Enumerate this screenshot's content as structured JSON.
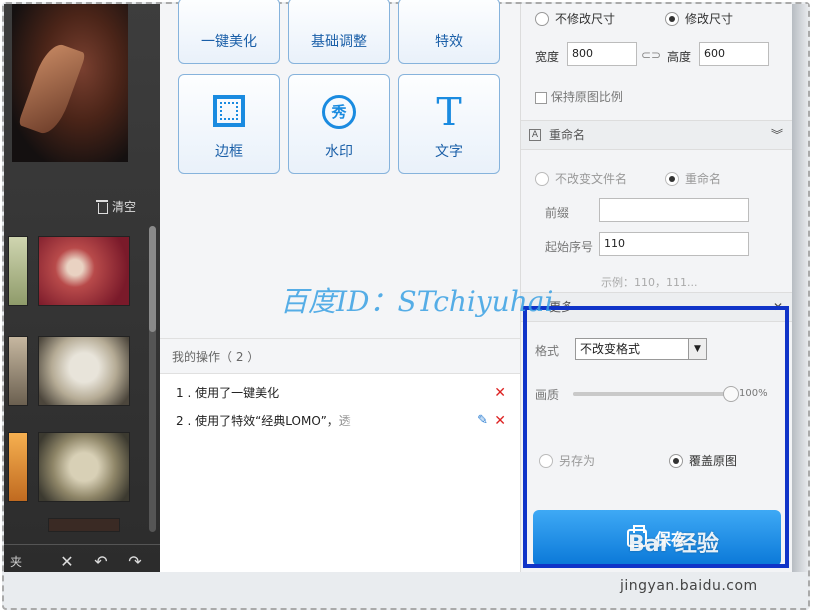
{
  "left_panel": {
    "clear_label": "清空",
    "folder_label_fragment": "夹"
  },
  "tools": [
    {
      "id": "one-click",
      "label": "一键美化"
    },
    {
      "id": "basic-adjust",
      "label": "基础调整"
    },
    {
      "id": "effects",
      "label": "特效"
    },
    {
      "id": "frame",
      "label": "边框"
    },
    {
      "id": "watermark",
      "label": "水印",
      "icon_text": "秀"
    },
    {
      "id": "text",
      "label": "文字",
      "icon_text": "T"
    }
  ],
  "operations": {
    "header": "我的操作（ 2 ）",
    "items": [
      {
        "text": "1 . 使用了一键美化"
      },
      {
        "text": "2 . 使用了特效“经典LOMO”，透"
      }
    ]
  },
  "resize": {
    "option_keep": "不修改尺寸",
    "option_change": "修改尺寸",
    "width_label": "宽度",
    "width_value": "800",
    "height_label": "高度",
    "height_value": "600",
    "keep_ratio_label": "保持原图比例"
  },
  "rename": {
    "section_title": "重命名",
    "option_keep": "不改变文件名",
    "option_rename": "重命名",
    "prefix_label": "前缀",
    "prefix_value": "",
    "start_label": "起始序号",
    "start_value": "110",
    "example": "示例：110，111..."
  },
  "more": {
    "section_title": "更多",
    "format_label": "格式",
    "format_value": "不改变格式",
    "quality_label": "画质",
    "quality_value": "100%",
    "quality_level": 1.0,
    "option_save_as": "另存为",
    "option_overwrite": "覆盖原图",
    "save_label": "保存"
  },
  "overlay": {
    "watermark": "百度ID：STchiyuhai",
    "baidu_logo": "Bai 经验",
    "baidu_url": "jingyan.baidu.com"
  },
  "colors": {
    "accent": "#1a8be0",
    "highlight": "#1034c8",
    "delete": "#dd2222"
  }
}
